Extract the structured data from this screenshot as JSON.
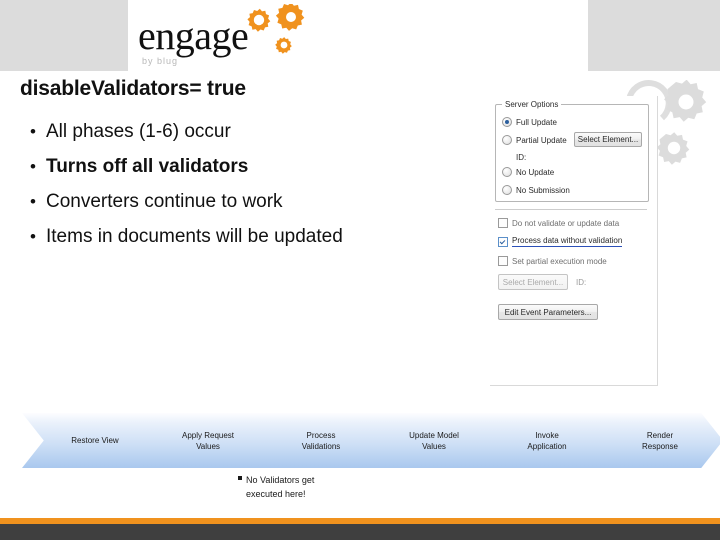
{
  "brand": {
    "logo_word": "engage",
    "logo_sub": "by blug",
    "accent_orange": "#f0921e",
    "footer_dark": "#3f3f3f",
    "band_gray": "#dcdcdc"
  },
  "slide": {
    "title": "disableValidators= true",
    "bullets": [
      {
        "text": "All phases (1-6) occur",
        "bold": false
      },
      {
        "text": "Turns off all validators",
        "bold": true
      },
      {
        "text": "Converters continue to work",
        "bold": false
      },
      {
        "text": "Items in documents will be updated",
        "bold": false
      }
    ]
  },
  "screenshot": {
    "group_title": "Server Options",
    "radios": [
      {
        "label": "Full Update",
        "selected": true
      },
      {
        "label": "Partial Update",
        "selected": false
      },
      {
        "label": "No Update",
        "selected": false
      },
      {
        "label": "No Submission",
        "selected": false
      }
    ],
    "select_element_button": "Select Element...",
    "id_label": "ID:",
    "checkboxes": [
      {
        "label": "Do not validate or update data",
        "checked": false,
        "highlighted": false
      },
      {
        "label": "Process data without validation",
        "checked": true,
        "highlighted": true
      },
      {
        "label": "Set partial execution mode",
        "checked": false,
        "highlighted": false
      }
    ],
    "select_element_button_disabled": "Select Element...",
    "id_label_2": "ID:",
    "edit_event_button": "Edit Event Parameters..."
  },
  "flow": {
    "phases": [
      {
        "line1": "Restore View",
        "line2": ""
      },
      {
        "line1": "Apply Request",
        "line2": "Values"
      },
      {
        "line1": "Process",
        "line2": "Validations"
      },
      {
        "line1": "Update Model",
        "line2": "Values"
      },
      {
        "line1": "Invoke",
        "line2": "Application"
      },
      {
        "line1": "Render",
        "line2": "Response"
      }
    ],
    "annotation_line1": "No Validators get",
    "annotation_line2": "executed here!"
  }
}
